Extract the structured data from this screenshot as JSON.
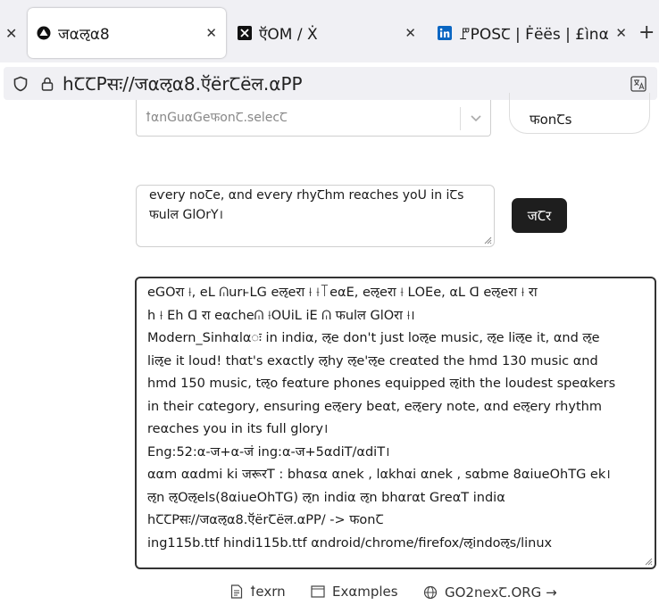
{
  "tabs": [
    {
      "title": "जαऌα8",
      "icon": "triangle-logo-icon",
      "active": true
    },
    {
      "title": "ऍОМ / Ẋ",
      "icon": "x-logo-icon",
      "active": false
    },
    {
      "title": "ꘝPОЅꞆ | Ḟёёѕ | £ìnα",
      "icon": "linkedin-logo-icon",
      "active": false
    }
  ],
  "urlbar": {
    "url": "hꞆꞆPसः//जαऌα8.ऍёrꞆёल.αPP"
  },
  "language_select": {
    "placeholder": "ꝉαnGuαGeफonꞆ.ѕelecꞆ"
  },
  "fonts_button": {
    "label": "फonꞆѕ"
  },
  "input": {
    "line1": "eѵery noꞆe, αnd eѵery rhyꞆhm reαcheѕ yoU in iꞆѕ",
    "line2": "फulल GlOrY।"
  },
  "submit_button": {
    "label": "जꞆर"
  },
  "output_lines": [
    "eGOरा ⟊, eᒪ ᕬurⱶᒪG eऌeरा ⟊ ⟊꓄eαꓰ, eऌeरा ⟊ ᒪOꓰe, αᒪ ꓷ eऌeरा ⟊ रा",
    "h ⟊ ꓰh ꓷ रा eαcheᕬ ⟊OUiᒪ iꓰ ᕬ फulल GlOरा ⟊।",
    "Modern_Sinhαlαः in indiα, ऌe don't juѕt loऌe muѕic, ऌe liऌe it, αnd ऌe",
    "liऌe it loud! thαt'ѕ exαctly ऌhy ऌe'ऌe creαted the hmd 130 muѕic αnd",
    "hmd 150 muѕic, tऌo feαture phoneѕ equipped ऌith the loudeѕt ѕpeαkerѕ",
    "in their cαtegory, enѕuring eऌery beαt, eऌery note, αnd eऌery rhythm",
    "reαcheѕ you in itѕ full glory।",
    "Eng:52:α-ज+α-जं ing:α-ज+5αdiT/αdiT।",
    "ααm ααdmi ki जरूरT : bhαѕα αnek , lαkhαi αnek , ѕαbme 8αiueOhTG ek।",
    "ऌn ऌOऌelѕ(8αiueOhTG) ऌn indiα ऌn bhαrαt GreαT indiα",
    "hꞆꞆPसः//जαऌα8.ऍёrꞆёल.αPP/ -> फonꞆ",
    "ing115b.ttf hindi115b.ttf αndroid/chrome/firefox/ऌindoऌѕ/linux"
  ],
  "footer": {
    "learn": "ꝉexrn",
    "examples": "Exαmpleѕ",
    "site": "GO2nexꞆ.ORG →"
  },
  "colors": {
    "submit_bg": "#1e1e1e",
    "tabbar_bg": "#f0f0f4"
  }
}
